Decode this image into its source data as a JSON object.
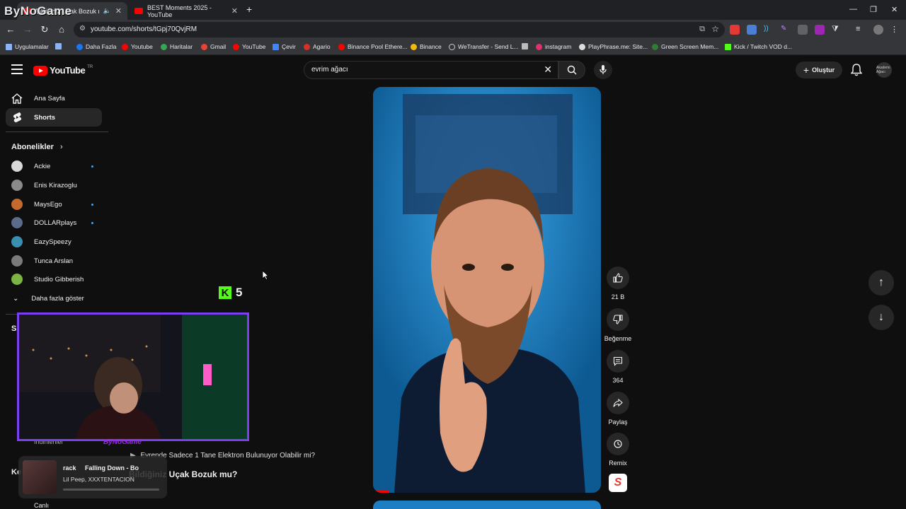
{
  "browser": {
    "tabs": [
      {
        "title": "Bildiğiniz Uçak Bozuk mu?",
        "active": true
      },
      {
        "title": "BEST Moments 2025 - YouTube",
        "active": false
      }
    ],
    "url": "youtube.com/shorts/tGpj70QvjRM",
    "bookmarks": [
      "Uygulamalar",
      "Daha Fazla",
      "Youtube",
      "Haritalar",
      "Gmail",
      "YouTube",
      "Çevir",
      "Agario",
      "Binance Pool Ethere...",
      "Binance",
      "WeTransfer - Send L...",
      "instagram",
      "PlayPhrase.me: Site...",
      "Green Screen Mem...",
      "Kick / Twitch VOD d..."
    ]
  },
  "overlay": {
    "logo_text": "ByNoGame",
    "kick_viewers": "5",
    "webcam_name": "ByNoGame"
  },
  "youtube": {
    "logo": "YouTube",
    "logo_country": "TR",
    "search_query": "evrim ağacı",
    "create_label": "Oluştur",
    "avatar_text": "Akademi Ağacı"
  },
  "sidebar": {
    "main": [
      {
        "label": "Ana Sayfa",
        "icon": "home-icon"
      },
      {
        "label": "Shorts",
        "icon": "shorts-icon",
        "active": true
      }
    ],
    "subscriptions_header": "Abonelikler",
    "subscriptions": [
      {
        "label": "Ackie",
        "new": true,
        "color": "#d9d9d9"
      },
      {
        "label": "Enis Kirazoglu",
        "new": false,
        "color": "#8a8a8a"
      },
      {
        "label": "MaysEgo",
        "new": true,
        "color": "#c46a2e"
      },
      {
        "label": "DOLLARplays",
        "new": true,
        "color": "#5b6c8a"
      },
      {
        "label": "EazySpeezy",
        "new": false,
        "color": "#3a8fb0"
      },
      {
        "label": "Tunca Arslan",
        "new": false,
        "color": "#7a7a7a"
      },
      {
        "label": "Studio Gibberish",
        "new": false,
        "color": "#7cb342"
      }
    ],
    "show_more": "Daha fazla göster",
    "partial_items": [
      "S",
      "İndirilenler",
      "Ke",
      "Canlı"
    ]
  },
  "short": {
    "title": "Bildiğiniz Uçak Bozuk mu?",
    "description": "Evrende Sadece 1 Tane Elektron Bulunuyor Olabilir mi?",
    "like_count": "21 B",
    "dislike_label": "Beğenme",
    "comment_count": "364",
    "share_label": "Paylaş",
    "remix_label": "Remix"
  },
  "music_widget": {
    "track": "rack     Falling Down - Bo",
    "artist": "Lil Peep, XXXTENTACION",
    "progress": 0.0
  },
  "colors": {
    "youtube_red": "#ff0000",
    "kick_green": "#53fc18",
    "webcam_border": "#7b3ff2"
  }
}
